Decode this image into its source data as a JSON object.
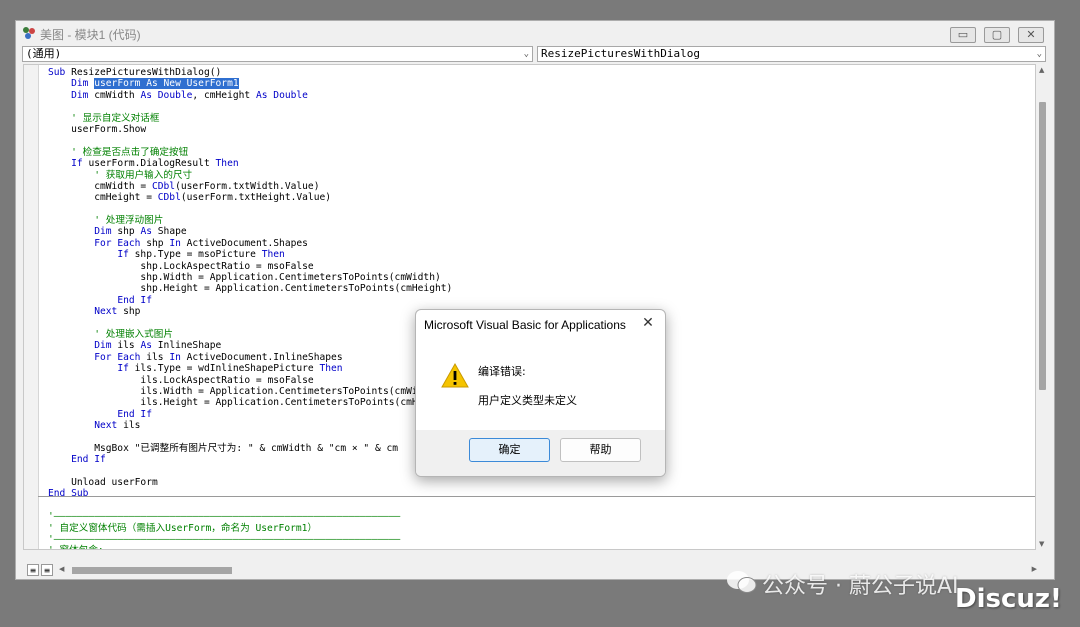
{
  "window": {
    "title": "美图 - 模块1 (代码)",
    "min_label": "▭",
    "max_label": "▢",
    "close_label": "✕"
  },
  "combos": {
    "object": "(通用)",
    "procedure": "ResizePicturesWithDialog"
  },
  "code_lines": [
    [
      {
        "t": "Sub ",
        "k": "kw"
      },
      {
        "t": "ResizePicturesWithDialog()"
      }
    ],
    [
      {
        "t": "    "
      },
      {
        "t": "Dim ",
        "k": "kw"
      },
      {
        "t": "userForm As New UserForm1",
        "k": "sel"
      }
    ],
    [
      {
        "t": "    "
      },
      {
        "t": "Dim ",
        "k": "kw"
      },
      {
        "t": "cmWidth "
      },
      {
        "t": "As Double",
        "k": "kw"
      },
      {
        "t": ", cmHeight "
      },
      {
        "t": "As Double",
        "k": "kw"
      }
    ],
    [
      {
        "t": ""
      }
    ],
    [
      {
        "t": "    "
      },
      {
        "t": "' 显示自定义对话框",
        "k": "cm"
      }
    ],
    [
      {
        "t": "    userForm.Show"
      }
    ],
    [
      {
        "t": ""
      }
    ],
    [
      {
        "t": "    "
      },
      {
        "t": "' 检查是否点击了确定按钮",
        "k": "cm"
      }
    ],
    [
      {
        "t": "    "
      },
      {
        "t": "If ",
        "k": "kw"
      },
      {
        "t": "userForm.DialogResult "
      },
      {
        "t": "Then",
        "k": "kw"
      }
    ],
    [
      {
        "t": "        "
      },
      {
        "t": "' 获取用户输入的尺寸",
        "k": "cm"
      }
    ],
    [
      {
        "t": "        cmWidth = "
      },
      {
        "t": "CDbl",
        "k": "kw"
      },
      {
        "t": "(userForm.txtWidth.Value)"
      }
    ],
    [
      {
        "t": "        cmHeight = "
      },
      {
        "t": "CDbl",
        "k": "kw"
      },
      {
        "t": "(userForm.txtHeight.Value)"
      }
    ],
    [
      {
        "t": ""
      }
    ],
    [
      {
        "t": "        "
      },
      {
        "t": "' 处理浮动图片",
        "k": "cm"
      }
    ],
    [
      {
        "t": "        "
      },
      {
        "t": "Dim ",
        "k": "kw"
      },
      {
        "t": "shp "
      },
      {
        "t": "As ",
        "k": "kw"
      },
      {
        "t": "Shape"
      }
    ],
    [
      {
        "t": "        "
      },
      {
        "t": "For Each ",
        "k": "kw"
      },
      {
        "t": "shp "
      },
      {
        "t": "In ",
        "k": "kw"
      },
      {
        "t": "ActiveDocument.Shapes"
      }
    ],
    [
      {
        "t": "            "
      },
      {
        "t": "If ",
        "k": "kw"
      },
      {
        "t": "shp.Type = msoPicture "
      },
      {
        "t": "Then",
        "k": "kw"
      }
    ],
    [
      {
        "t": "                shp.LockAspectRatio = msoFalse"
      }
    ],
    [
      {
        "t": "                shp.Width = Application.CentimetersToPoints(cmWidth)"
      }
    ],
    [
      {
        "t": "                shp.Height = Application.CentimetersToPoints(cmHeight)"
      }
    ],
    [
      {
        "t": "            "
      },
      {
        "t": "End If",
        "k": "kw"
      }
    ],
    [
      {
        "t": "        "
      },
      {
        "t": "Next ",
        "k": "kw"
      },
      {
        "t": "shp"
      }
    ],
    [
      {
        "t": ""
      }
    ],
    [
      {
        "t": "        "
      },
      {
        "t": "' 处理嵌入式图片",
        "k": "cm"
      }
    ],
    [
      {
        "t": "        "
      },
      {
        "t": "Dim ",
        "k": "kw"
      },
      {
        "t": "ils "
      },
      {
        "t": "As ",
        "k": "kw"
      },
      {
        "t": "InlineShape"
      }
    ],
    [
      {
        "t": "        "
      },
      {
        "t": "For Each ",
        "k": "kw"
      },
      {
        "t": "ils "
      },
      {
        "t": "In ",
        "k": "kw"
      },
      {
        "t": "ActiveDocument.InlineShapes"
      }
    ],
    [
      {
        "t": "            "
      },
      {
        "t": "If ",
        "k": "kw"
      },
      {
        "t": "ils.Type = wdInlineShapePicture "
      },
      {
        "t": "Then",
        "k": "kw"
      }
    ],
    [
      {
        "t": "                ils.LockAspectRatio = msoFalse"
      }
    ],
    [
      {
        "t": "                ils.Width = Application.CentimetersToPoints(cmWid"
      }
    ],
    [
      {
        "t": "                ils.Height = Application.CentimetersToPoints(cmHe"
      }
    ],
    [
      {
        "t": "            "
      },
      {
        "t": "End If",
        "k": "kw"
      }
    ],
    [
      {
        "t": "        "
      },
      {
        "t": "Next ",
        "k": "kw"
      },
      {
        "t": "ils"
      }
    ],
    [
      {
        "t": ""
      }
    ],
    [
      {
        "t": "        MsgBox \"已调整所有图片尺寸为: \" & cmWidth & \"cm × \" & cm"
      }
    ],
    [
      {
        "t": "    "
      },
      {
        "t": "End If",
        "k": "kw"
      }
    ],
    [
      {
        "t": ""
      }
    ],
    [
      {
        "t": "    Unload userForm"
      }
    ],
    [
      {
        "t": "End Sub",
        "k": "kw"
      }
    ],
    [
      {
        "t": ""
      }
    ],
    [
      {
        "t": "'————————————————————————————————————————————————————————————",
        "k": "cm"
      }
    ],
    [
      {
        "t": "' 自定义窗体代码（需插入UserForm，命名为 UserForm1）",
        "k": "cm"
      }
    ],
    [
      {
        "t": "'————————————————————————————————————————————————————————————",
        "k": "cm"
      }
    ],
    [
      {
        "t": "' 窗体包含:",
        "k": "cm"
      }
    ]
  ],
  "dialog": {
    "title": "Microsoft Visual Basic for Applications",
    "close_label": "✕",
    "message_heading": "编译错误:",
    "message_body": "用户定义类型未定义",
    "ok_label": "确定",
    "help_label": "帮助"
  },
  "watermark": {
    "text": "公众号 · 蔚公子说AI",
    "forum": "Discuz!"
  },
  "colors": {
    "keyword": "#0000c8",
    "comment": "#008000",
    "selection": "#2f6fd0"
  }
}
